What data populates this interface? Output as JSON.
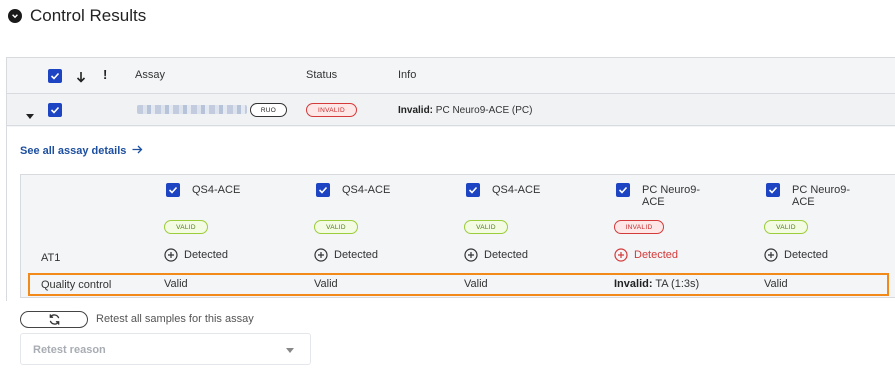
{
  "section": {
    "title": "Control Results"
  },
  "table": {
    "headers": {
      "assay": "Assay",
      "status": "Status",
      "info": "Info"
    },
    "row": {
      "ruo_badge": "RUO",
      "status_badge": "INVALID",
      "info_label": "Invalid:",
      "info_text": " PC Neuro9-ACE (PC)"
    }
  },
  "details": {
    "link_label": "See all assay details",
    "assays": [
      {
        "name": "QS4-ACE",
        "badge": "VALID",
        "badge_status": "valid",
        "detection": "Detected",
        "qc_label": "",
        "qc": "Valid"
      },
      {
        "name": "QS4-ACE",
        "badge": "VALID",
        "badge_status": "valid",
        "detection": "Detected",
        "qc_label": "",
        "qc": "Valid"
      },
      {
        "name": "QS4-ACE",
        "badge": "VALID",
        "badge_status": "valid",
        "detection": "Detected",
        "qc_label": "",
        "qc": "Valid"
      },
      {
        "name": "PC Neuro9-ACE",
        "badge": "INVALID",
        "badge_status": "invalid",
        "detection": "Detected",
        "qc_label": "Invalid:",
        "qc": " TA (1:3s)"
      },
      {
        "name": "PC Neuro9-ACE",
        "badge": "VALID",
        "badge_status": "valid",
        "detection": "Detected",
        "qc_label": "",
        "qc": "Valid"
      }
    ],
    "rows": {
      "target": "AT1",
      "qc": "Quality control"
    }
  },
  "retest": {
    "label": "Retest all samples for this assay",
    "reason_placeholder": "Retest reason"
  },
  "colors": {
    "primary": "#1d44c2",
    "invalid": "#d43a3a",
    "valid_border": "#9ccd3a",
    "highlight": "#f28a1a",
    "link": "#1d4fa0"
  }
}
